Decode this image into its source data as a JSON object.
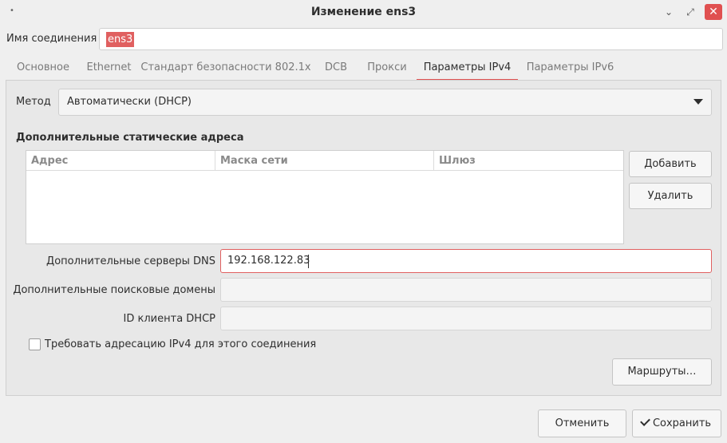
{
  "window": {
    "title": "Изменение ens3",
    "menu_icon": "dot-menu-icon",
    "minimize_icon": "minimize-icon",
    "maximize_icon": "maximize-icon",
    "close_icon": "close-icon",
    "close_symbol": "✕",
    "close_color": "#e05050"
  },
  "connection": {
    "name_label": "Имя соединения",
    "name_value": "ens3"
  },
  "tabs": [
    {
      "label": "Основное"
    },
    {
      "label": "Ethernet"
    },
    {
      "label": "Стандарт безопасности 802.1x"
    },
    {
      "label": "DCB"
    },
    {
      "label": "Прокси"
    },
    {
      "label": "Параметры IPv4",
      "active": true
    },
    {
      "label": "Параметры IPv6"
    }
  ],
  "ipv4": {
    "method_label": "Метод",
    "method_value": "Автоматически (DHCP)",
    "static_title": "Дополнительные статические адреса",
    "columns": [
      "Адрес",
      "Маска сети",
      "Шлюз"
    ],
    "add_button": "Добавить",
    "delete_button": "Удалить",
    "dns_label": "Дополнительные серверы DNS",
    "dns_value": "192.168.122.83",
    "search_label": "Дополнительные поисковые домены",
    "search_value": "",
    "dhcp_id_label": "ID клиента DHCP",
    "dhcp_id_value": "",
    "require_label": "Требовать адресацию IPv4 для этого соединения",
    "require_checked": false,
    "routes_button": "Маршруты…"
  },
  "footer": {
    "cancel": "Отменить",
    "save": "Сохранить"
  },
  "colors": {
    "accent": "#e05050"
  }
}
